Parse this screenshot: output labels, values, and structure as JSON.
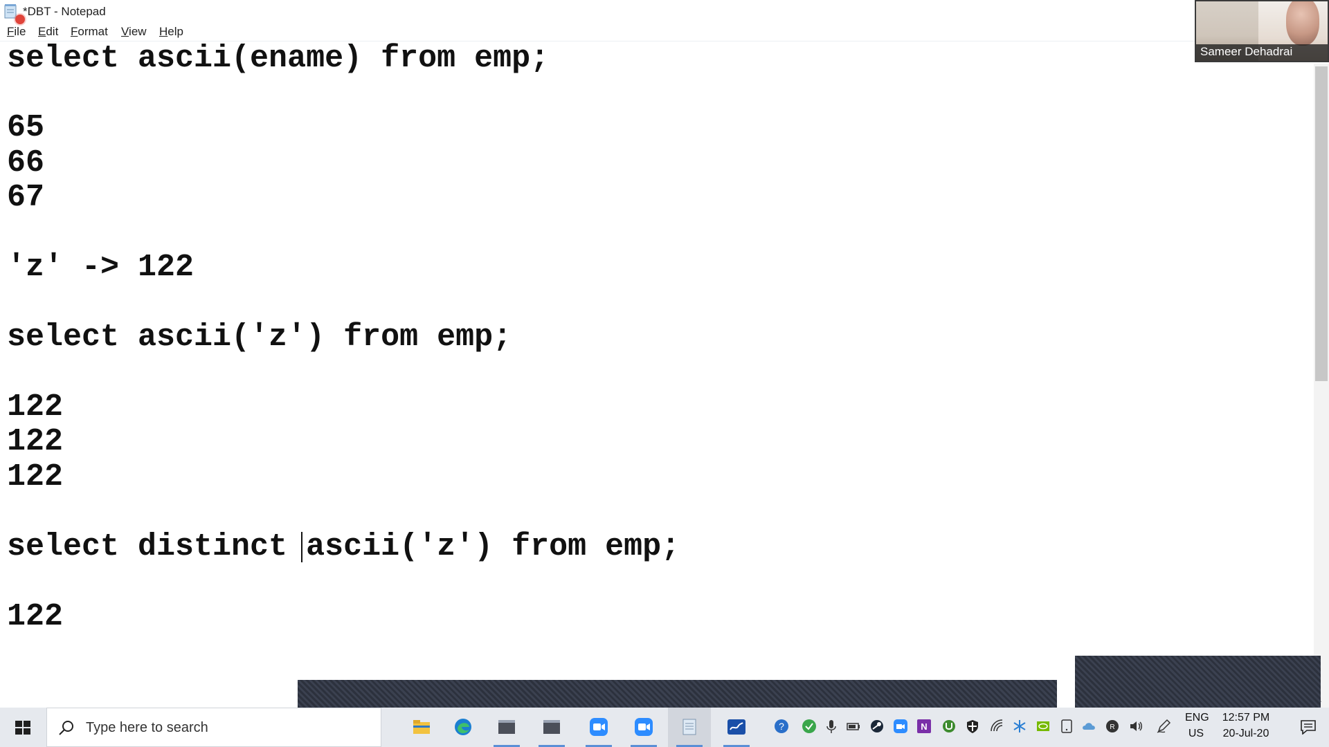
{
  "window": {
    "title": "*DBT - Notepad"
  },
  "menu": {
    "items": [
      "File",
      "Edit",
      "Format",
      "View",
      "Help"
    ]
  },
  "editor": {
    "lines": [
      "select ascii(ename) from emp;",
      "65",
      "66",
      "67",
      "'z' -> 122",
      "select ascii('z') from emp;",
      "122",
      "122",
      "122",
      "select distinct ascii('z') from emp;",
      "122"
    ]
  },
  "video": {
    "participant_name": "Sameer Dehadrai"
  },
  "taskbar": {
    "search_placeholder": "Type here to search",
    "apps": [
      "file-explorer-icon",
      "edge-icon",
      "sql-plus-icon",
      "sql-plus-icon",
      "zoom-icon",
      "zoom-icon",
      "notepad-icon",
      "whiteboard-icon"
    ],
    "language_top": "ENG",
    "language_bottom": "US",
    "time": "12:57 PM",
    "date": "20-Jul-20"
  },
  "colors": {
    "taskbar_bg": "#e6e9ee",
    "accent": "#5a8fd6",
    "record": "#e0443a"
  }
}
